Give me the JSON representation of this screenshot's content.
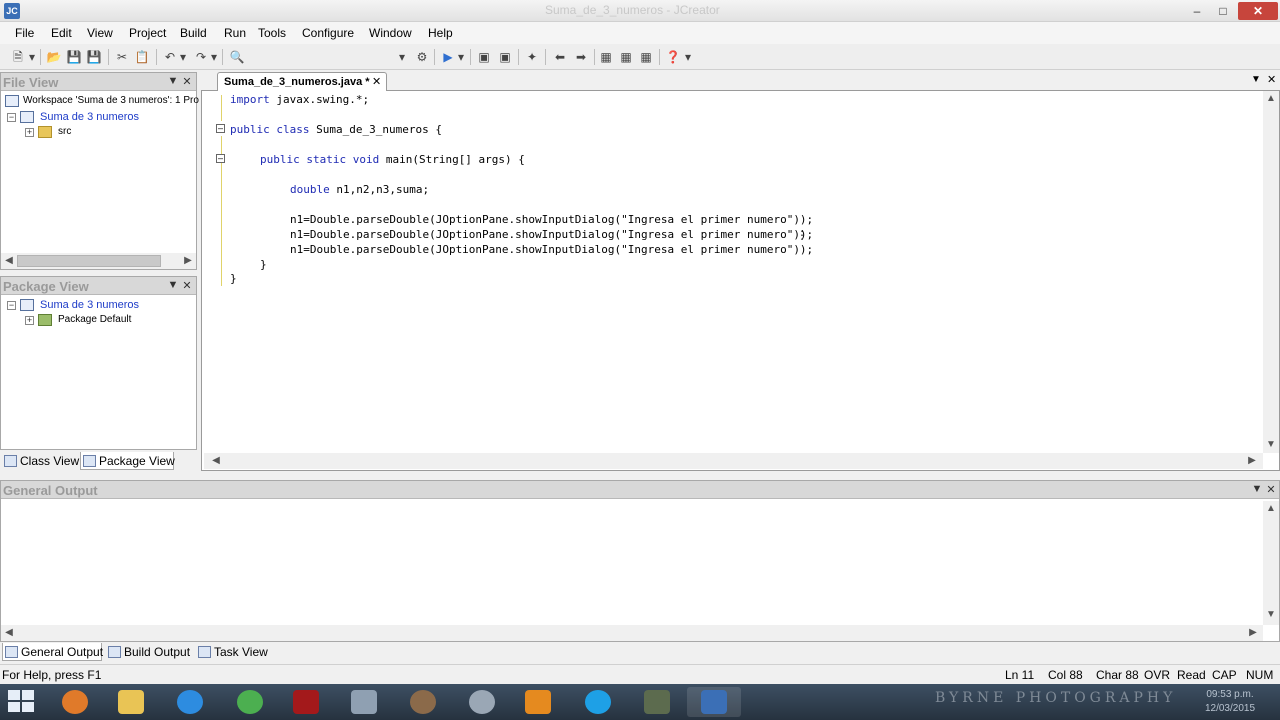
{
  "window": {
    "title": "Suma_de_3_numeros - JCreator",
    "app_badge": "JC"
  },
  "menu": [
    "File",
    "Edit",
    "View",
    "Project",
    "Build",
    "Run",
    "Tools",
    "Configure",
    "Window",
    "Help"
  ],
  "file_view": {
    "title": "File View",
    "workspace": "Workspace 'Suma de 3 numeros': 1 Pro",
    "project": "Suma de 3 numeros",
    "folder": "src"
  },
  "package_view": {
    "title": "Package View",
    "project": "Suma de 3 numeros",
    "package": "Package Default"
  },
  "left_tabs": {
    "class_view": "Class View",
    "package_view": "Package View"
  },
  "editor": {
    "tab_label": "Suma_de_3_numeros.java *",
    "lines": [
      {
        "indent": "",
        "kw": "import",
        "rest": " javax.swing.*;"
      },
      {
        "indent": "",
        "kw": "public class",
        "rest": " Suma_de_3_numeros {"
      },
      {
        "indent": "    ",
        "kw": "public static void",
        "rest": " main(String[] args) {"
      },
      {
        "indent": "        ",
        "kw": "double",
        "rest": " n1,n2,n3,suma;"
      },
      {
        "indent": "        ",
        "kw": "",
        "rest": "n1=Double.parseDouble(JOptionPane.showInputDialog(\"Ingresa el primer numero\"));"
      },
      {
        "indent": "        ",
        "kw": "",
        "rest": "n1=Double.parseDouble(JOptionPane.showInputDialog(\"Ingresa el primer numero\"));"
      },
      {
        "indent": "        ",
        "kw": "",
        "rest": "n1=Double.parseDouble(JOptionPane.showInputDialog(\"Ingresa el primer numero\"));"
      },
      {
        "indent": "    ",
        "kw": "",
        "rest": "}"
      },
      {
        "indent": "",
        "kw": "",
        "rest": "}"
      }
    ]
  },
  "output_panel": {
    "title": "General Output"
  },
  "output_tabs": {
    "general": "General Output",
    "build": "Build Output",
    "task": "Task View"
  },
  "status": {
    "help": "For Help, press F1",
    "line": "Ln 11",
    "col": "Col 88",
    "char": "Char 88",
    "ovr": "OVR",
    "read": "Read",
    "cap": "CAP",
    "num": "NUM"
  },
  "taskbar": {
    "watermark": "BYRNE PHOTOGRAPHY",
    "time": "09:53 p.m.",
    "date": "12/03/2015"
  },
  "colors": {
    "keyword": "#1f2bb4",
    "tree_link": "#1e3cc8",
    "close_button": "#c7453c",
    "taskbar": "#26323f"
  }
}
